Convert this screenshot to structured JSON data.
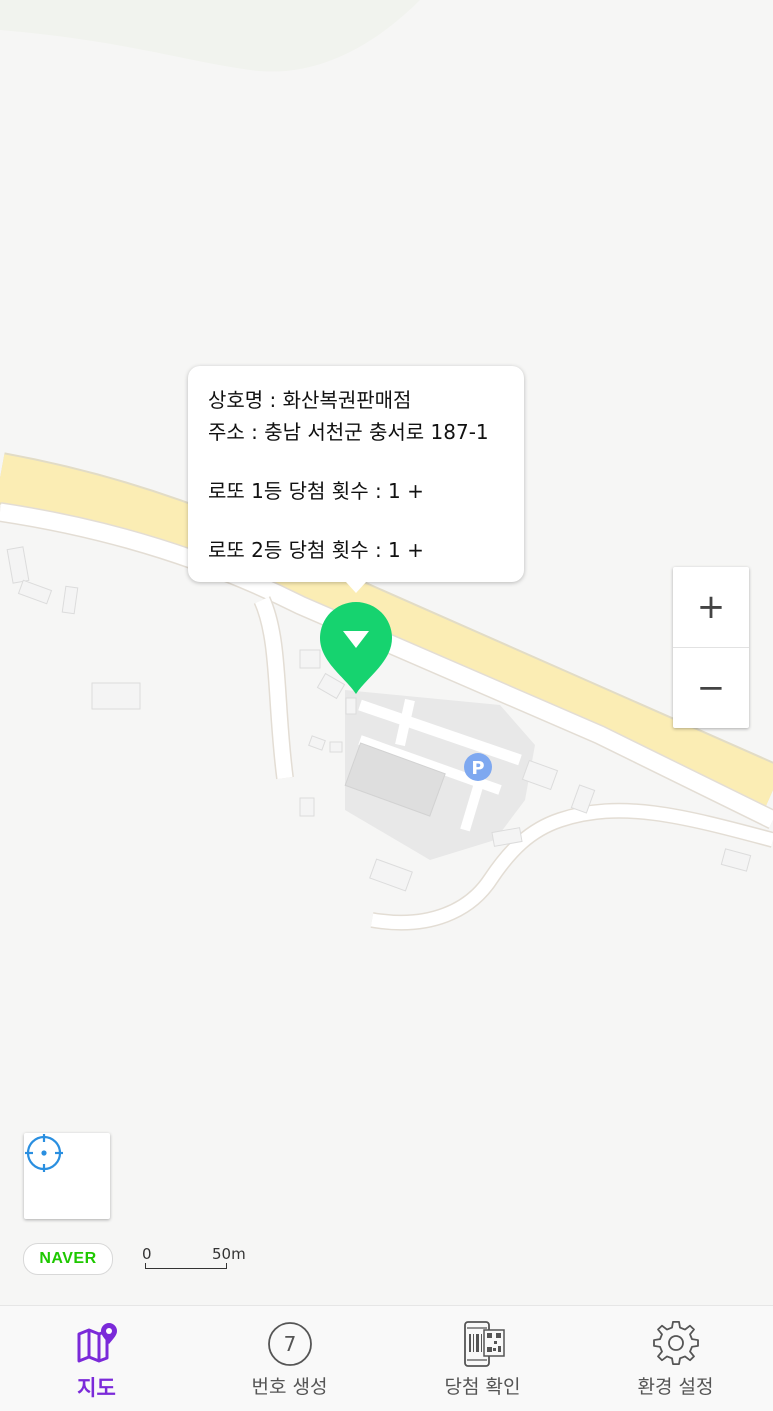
{
  "map": {
    "brand": "NAVER",
    "scale": {
      "start": "0",
      "end": "50m"
    },
    "zoom": {
      "in_symbol": "+",
      "out_symbol": "−"
    },
    "parking_symbol": "P"
  },
  "info": {
    "name_line": "상호명 : 화산복권판매점",
    "address_line": "주소 : 충남 서천군 충서로 187-1",
    "first_prize_line": "로또 1등 당첨 횟수 :  1 +",
    "second_prize_line": "로또 2등 당첨 횟수 :  1 +"
  },
  "marker": {
    "color": "#16d36f"
  },
  "nav": {
    "active_color": "#7b2ad9",
    "items": [
      {
        "label": "지도",
        "icon": "map-pin-icon"
      },
      {
        "label": "번호 생성",
        "icon": "number-ball-icon",
        "badge": "7"
      },
      {
        "label": "당첨 확인",
        "icon": "qr-phone-icon"
      },
      {
        "label": "환경 설정",
        "icon": "gear-icon"
      }
    ]
  }
}
